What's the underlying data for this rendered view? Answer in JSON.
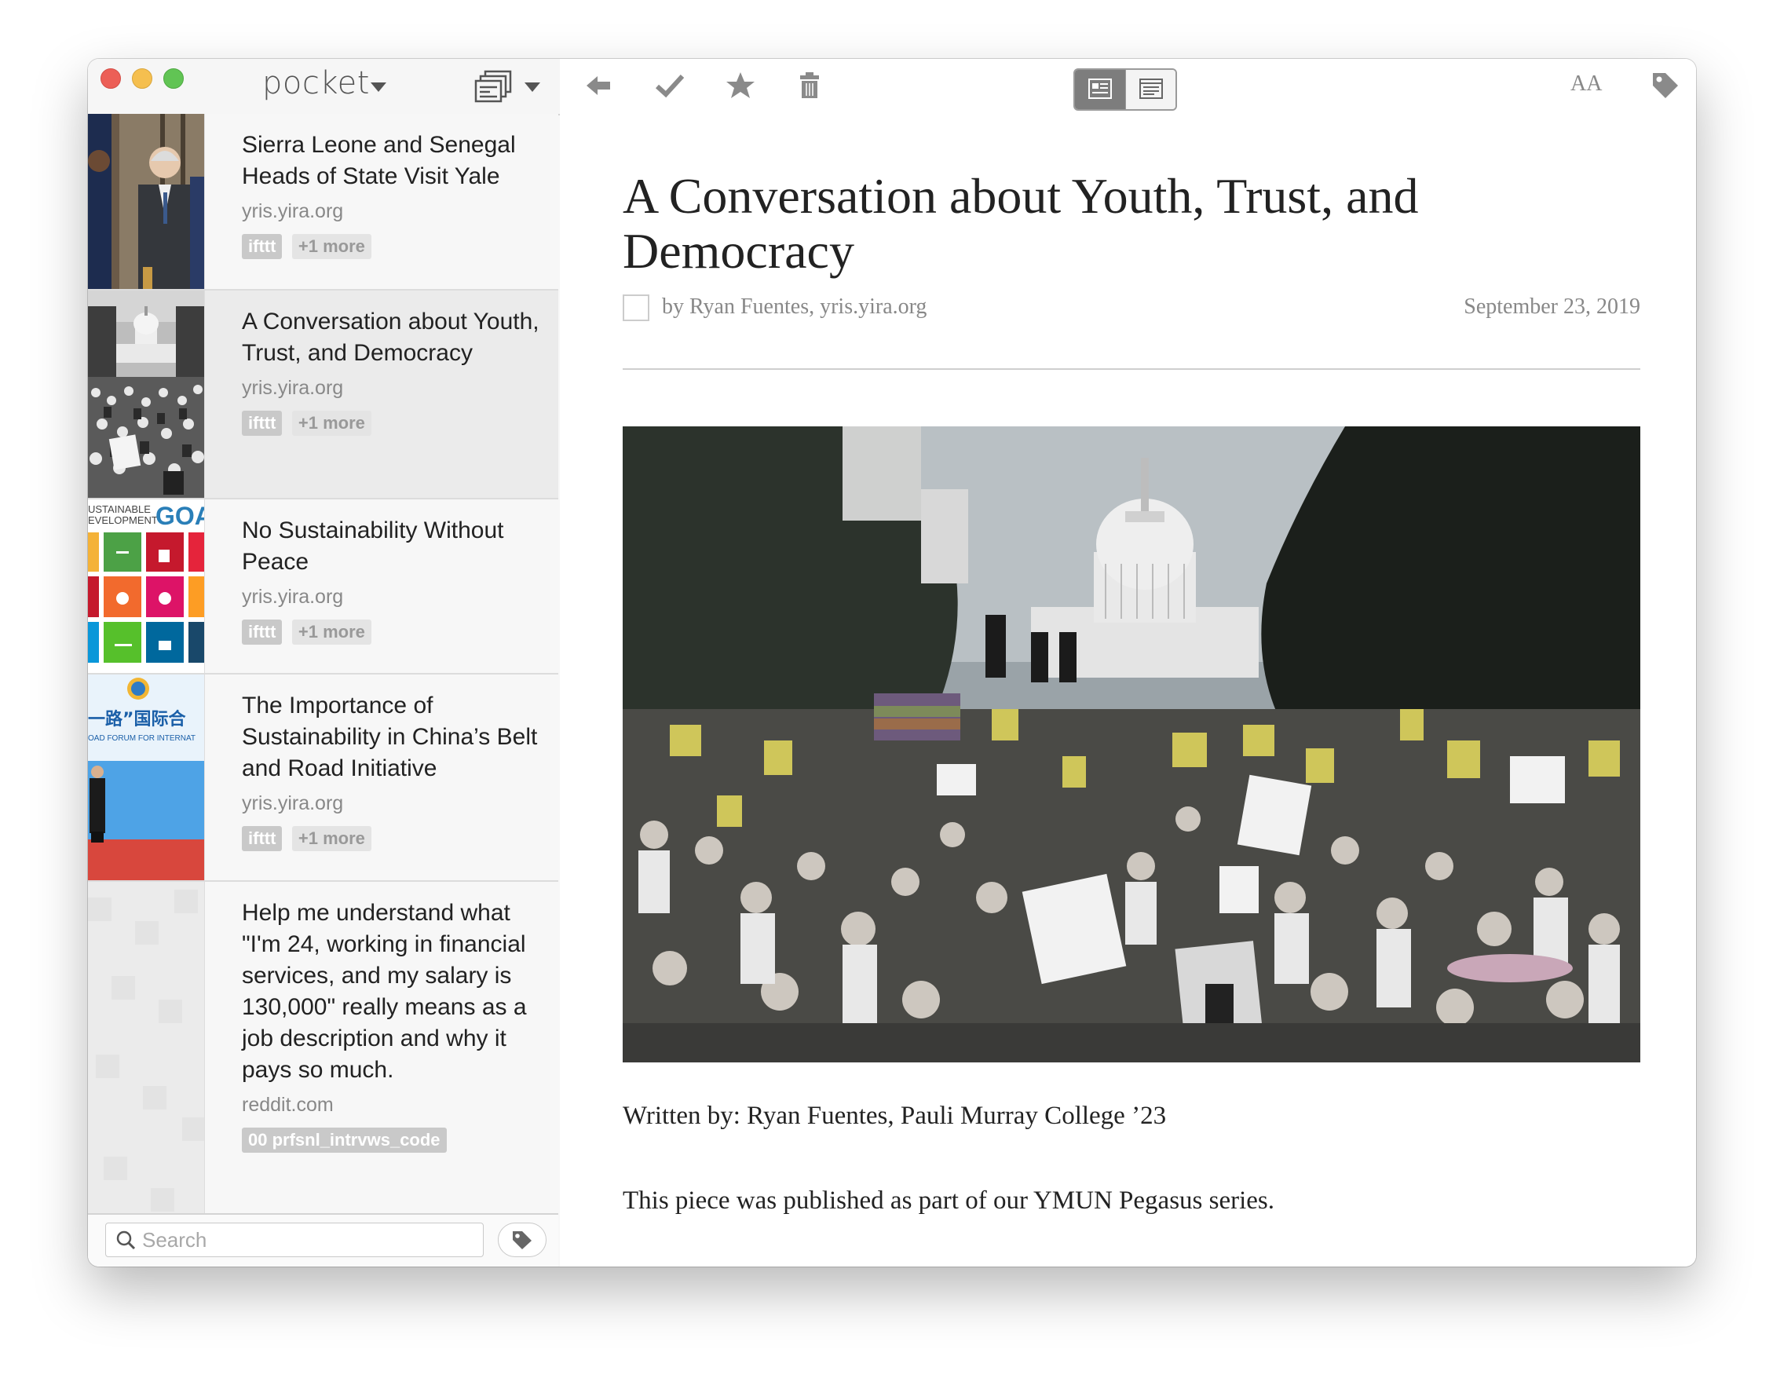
{
  "app": {
    "logo": "pocket"
  },
  "articles": [
    {
      "title": "Sierra Leone and Senegal Heads of State Visit Yale",
      "domain": "yris.yira.org",
      "tags": [
        "ifttt",
        "+1 more"
      ]
    },
    {
      "title": "A Conversation about Youth, Trust, and Democracy",
      "domain": "yris.yira.org",
      "tags": [
        "ifttt",
        "+1 more"
      ],
      "selected": true
    },
    {
      "title": "No Sustainability Without Peace",
      "domain": "yris.yira.org",
      "tags": [
        "ifttt",
        "+1 more"
      ]
    },
    {
      "title": "The Importance of Sustainability in China’s Belt and Road Initiative",
      "domain": "yris.yira.org",
      "tags": [
        "ifttt",
        "+1 more"
      ]
    },
    {
      "title": "Help me understand what \"I'm 24, working in financial services, and my salary is 130,000\" really means as a job description and why it pays so much.",
      "domain": "reddit.com",
      "tags": [
        "00 prfsnl_intrvws_code"
      ]
    }
  ],
  "thumb_text": {
    "sdg_line1": "USTAINABLE",
    "sdg_line2": "EVELOPMENT",
    "sdg_goals": "GOA",
    "bri_title": "一路”国际合",
    "bri_sub": "OAD FORUM FOR INTERNAT"
  },
  "search": {
    "placeholder": "Search"
  },
  "toolbar": {
    "font_label": "AA"
  },
  "article": {
    "title": "A Conversation about Youth, Trust, and Democracy",
    "byline": "by Ryan Fuentes, yris.yira.org",
    "date": "September 23, 2019",
    "paragraphs": [
      "Written by: Ryan Fuentes, Pauli Murray College ’23",
      "This piece was published as part of our YMUN Pegasus series."
    ]
  },
  "colors": {
    "close": "#ec5f57",
    "minimize": "#f5bf4f",
    "zoom": "#61c454",
    "tag_bg": "#c9c9c9",
    "selected_bg": "#ebebeb"
  }
}
